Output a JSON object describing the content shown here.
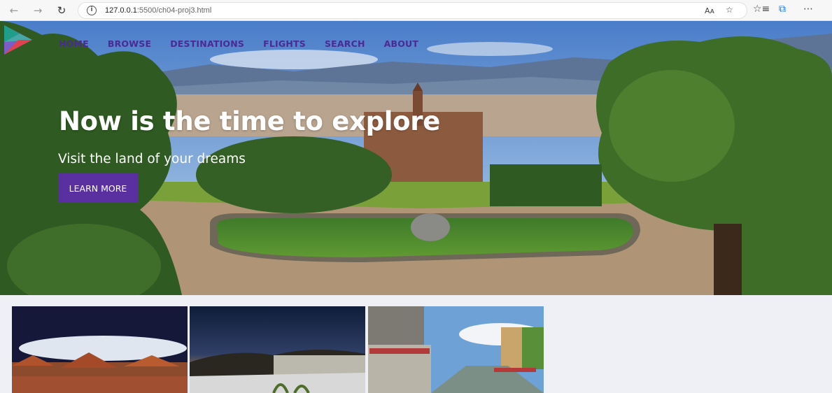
{
  "browser": {
    "back_icon": "arrow-left-icon",
    "forward_icon": "arrow-right-icon",
    "reload_icon": "reload-icon",
    "info_icon": "info-icon",
    "url_host": "127.0.0.1",
    "url_rest": ":5500/ch04-proj3.html",
    "read_aloud_icon": "read-aloud-icon",
    "favorite_icon": "star-icon",
    "favorites_icon": "favorites-icon",
    "collections_icon": "collections-icon",
    "more_icon": "more-icon"
  },
  "site": {
    "logo_icon": "play-logo-icon",
    "nav": [
      {
        "label": "HOME"
      },
      {
        "label": "BROWSE"
      },
      {
        "label": "DESTINATIONS"
      },
      {
        "label": "FLIGHTS"
      },
      {
        "label": "SEARCH"
      },
      {
        "label": "ABOUT"
      }
    ],
    "hero": {
      "title": "Now is the time to explore",
      "subtitle": "Visit the land of your dreams",
      "button": "LEARN MORE"
    },
    "accent_color": "#5a2fa0",
    "nav_color": "#4a2b93"
  }
}
